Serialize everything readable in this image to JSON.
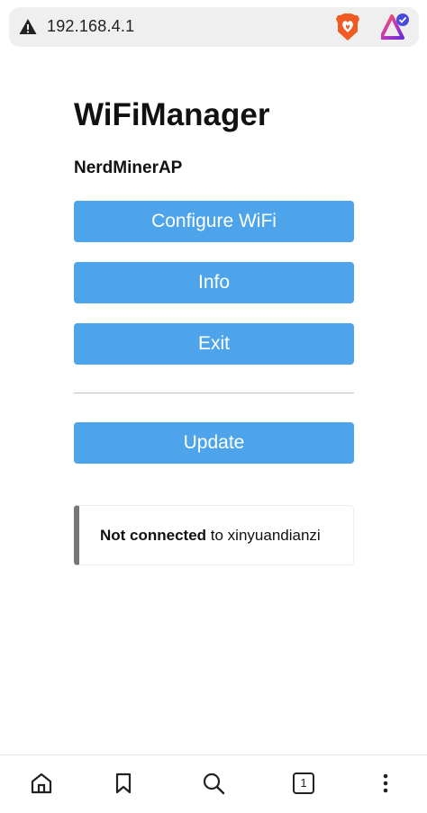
{
  "browser": {
    "url": "192.168.4.1",
    "tab_count": "1"
  },
  "page": {
    "title": "WiFiManager",
    "ap_name": "NerdMinerAP",
    "buttons": {
      "configure": "Configure WiFi",
      "info": "Info",
      "exit": "Exit",
      "update": "Update"
    },
    "status": {
      "strong": "Not connected",
      "rest": " to xinyuandianzi"
    }
  },
  "colors": {
    "button": "#4ea4ea",
    "status_border": "#777777"
  },
  "icons": {
    "address_warning": "warning-triangle-icon",
    "brave": "brave-shield-icon",
    "rewards": "rewards-triangle-icon",
    "home": "home-icon",
    "bookmark": "bookmark-icon",
    "search": "search-icon",
    "tabs": "tabs-icon",
    "menu": "more-vertical-icon"
  }
}
